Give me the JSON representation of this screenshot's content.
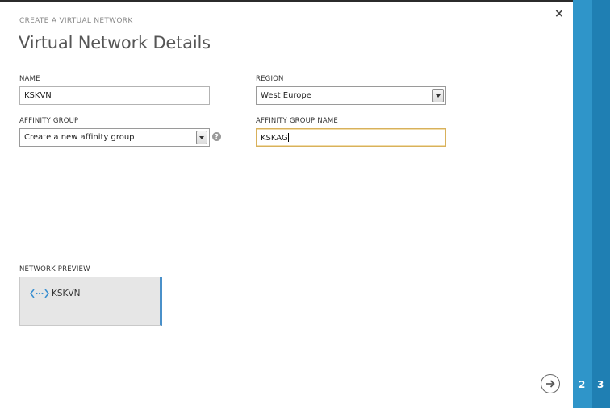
{
  "dialog": {
    "kicker": "CREATE A VIRTUAL NETWORK",
    "title": "Virtual Network Details",
    "close_glyph": "×"
  },
  "form": {
    "name_label": "NAME",
    "name_value": "KSKVN",
    "region_label": "REGION",
    "region_value": "West Europe",
    "affinity_label": "AFFINITY GROUP",
    "affinity_value": "Create a new affinity group",
    "affinity_name_label": "AFFINITY GROUP NAME",
    "affinity_name_value": "KSKAG",
    "help_glyph": "?"
  },
  "preview": {
    "label": "NETWORK PREVIEW",
    "network_name": "KSKVN",
    "icon": "virtual-network-icon"
  },
  "navigation": {
    "next_icon": "arrow-right-icon",
    "steps": [
      "2",
      "3"
    ]
  },
  "colors": {
    "rail_light": "#3f9fd0",
    "rail_mid": "#2f95c9",
    "rail_dark": "#1f7fb3",
    "focus_border": "#d8b15c",
    "network_icon": "#3a8fd0"
  }
}
